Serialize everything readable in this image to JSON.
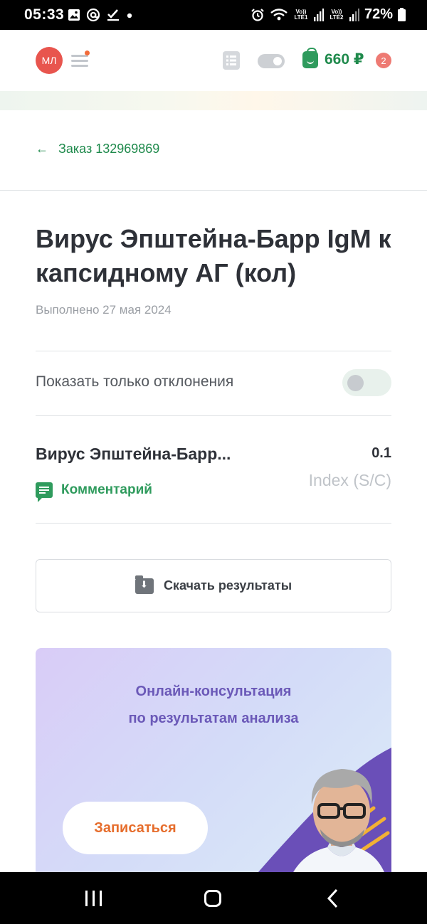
{
  "status_bar": {
    "time": "05:33",
    "battery": "72%",
    "sim1": "Vo)) LTE1",
    "sim2": "Vo)) LTE2",
    "icons": [
      "gallery-icon",
      "at-icon",
      "check-icon",
      "dot-icon",
      "alarm-icon",
      "wifi-icon",
      "signal-icon",
      "signal-icon",
      "battery-icon"
    ]
  },
  "header": {
    "avatar_initials": "МЛ",
    "cart_sum": "660 ₽",
    "cart_badge": "2",
    "colors": {
      "brand_green": "#1f8a4c",
      "avatar_red": "#e8554e",
      "badge": "#ee7a73"
    }
  },
  "back": {
    "label": "Заказ 132969869"
  },
  "page": {
    "title": "Вирус Эпштейна-Барр IgM к капсидному АГ (кол)",
    "subtitle": "Выполнено 27 мая 2024"
  },
  "filter": {
    "label": "Показать только отклонения",
    "enabled": false
  },
  "result": {
    "name": "Вирус Эпштейна-Барр...",
    "value": "0.1",
    "unit": "Index (S/C)",
    "comment_label": "Комментарий"
  },
  "download": {
    "label": "Скачать результаты"
  },
  "promo": {
    "line1": "Онлайн-консультация",
    "line2": "по результатам анализа",
    "button": "Записаться"
  }
}
